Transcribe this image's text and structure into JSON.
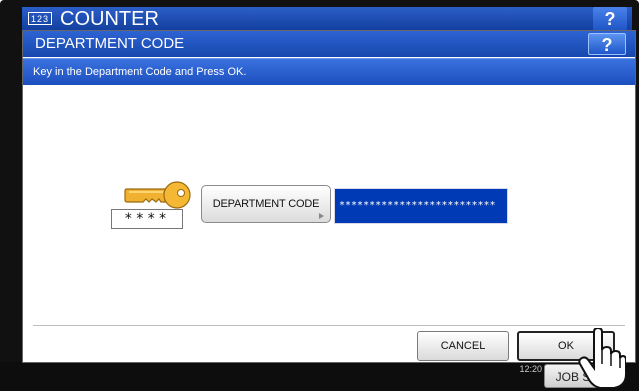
{
  "background_screen": {
    "counter_icon": "123",
    "title": "COUNTER",
    "help_label": "?",
    "datetime": "12:20",
    "job_button_label": "JOB S"
  },
  "dialog": {
    "title": "DEPARTMENT CODE",
    "help_label": "?",
    "instruction": "Key in the Department Code and Press OK.",
    "masked_code_display": "****",
    "department_code_button": "DEPARTMENT CODE",
    "code_field_value": "**************************",
    "cancel_label": "CANCEL",
    "ok_label": "OK"
  },
  "icons": {
    "key": "key-icon",
    "hand_cursor": "hand-pointer-icon",
    "arrow": "triangle-right-icon"
  },
  "colors": {
    "title_bar": "#1747ad",
    "code_field": "#003bb5",
    "key_gold": "#f0b030"
  }
}
